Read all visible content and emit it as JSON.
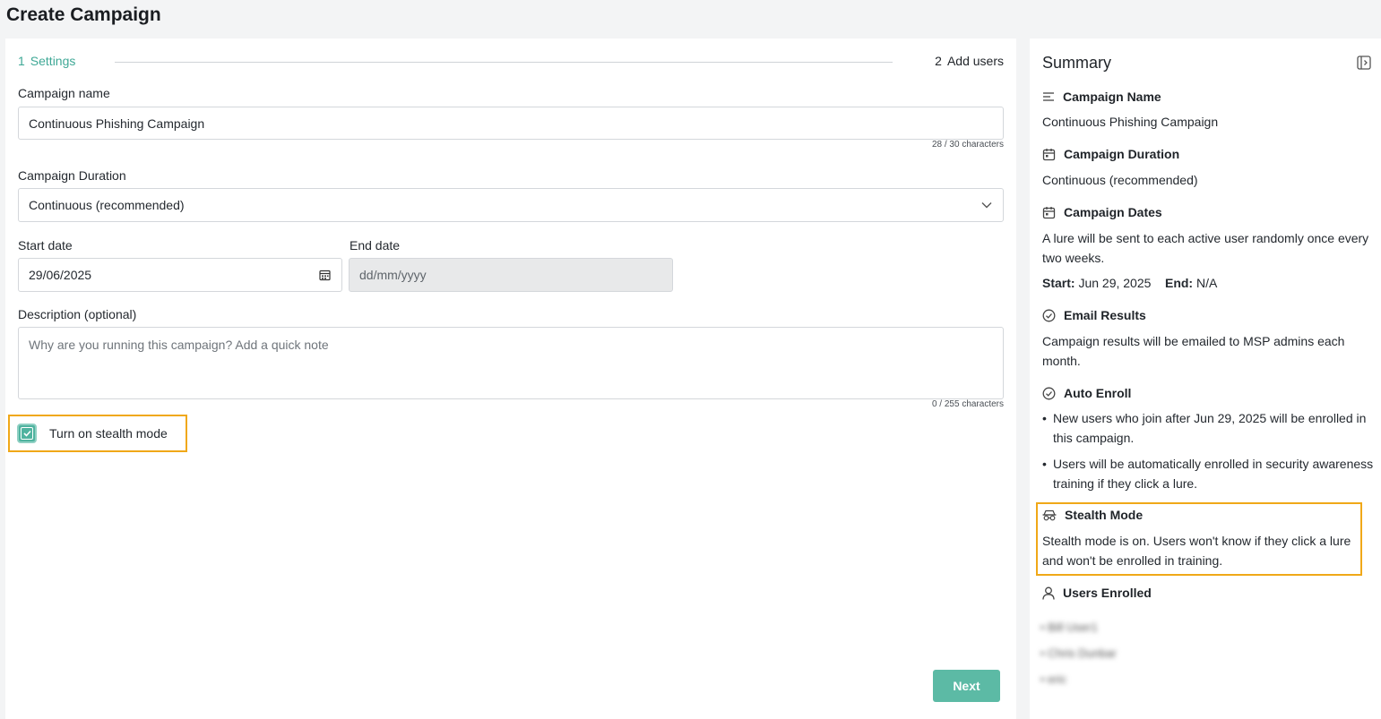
{
  "page": {
    "title": "Create Campaign"
  },
  "stepper": {
    "step1": {
      "number": "1",
      "label": "Settings"
    },
    "step2": {
      "number": "2",
      "label": "Add users"
    }
  },
  "form": {
    "campaign_name": {
      "label": "Campaign name",
      "value": "Continuous Phishing Campaign",
      "counter": "28 / 30 characters"
    },
    "duration": {
      "label": "Campaign Duration",
      "value": "Continuous (recommended)"
    },
    "start_date": {
      "label": "Start date",
      "value": "29/06/2025"
    },
    "end_date": {
      "label": "End date",
      "placeholder": "dd/mm/yyyy"
    },
    "description": {
      "label": "Description (optional)",
      "placeholder": "Why are you running this campaign? Add a quick note",
      "counter": "0 / 255 characters"
    },
    "stealth": {
      "label": "Turn on stealth mode",
      "checked": true
    },
    "next_label": "Next"
  },
  "summary": {
    "title": "Summary",
    "campaign_name": {
      "heading": "Campaign Name",
      "value": "Continuous Phishing Campaign"
    },
    "duration": {
      "heading": "Campaign Duration",
      "value": "Continuous (recommended)"
    },
    "dates": {
      "heading": "Campaign Dates",
      "description": "A lure will be sent to each active user randomly once every two weeks.",
      "start_label": "Start:",
      "start_value": "Jun 29, 2025",
      "end_label": "End:",
      "end_value": "N/A"
    },
    "email_results": {
      "heading": "Email Results",
      "text": "Campaign results will be emailed to MSP admins each month."
    },
    "auto_enroll": {
      "heading": "Auto Enroll",
      "items": [
        "New users who join after Jun 29, 2025 will be enrolled in this campaign.",
        "Users will be automatically enrolled in security awareness training if they click a lure."
      ]
    },
    "stealth_mode": {
      "heading": "Stealth Mode",
      "text": "Stealth mode is on. Users won't know if they click a lure and won't be enrolled in training."
    },
    "users_enrolled": {
      "heading": "Users Enrolled",
      "users": [
        "Bill User1",
        "Chris Dunbar",
        "eric"
      ]
    }
  },
  "colors": {
    "accent": "#5cbaa5",
    "highlight": "#f0a818"
  }
}
